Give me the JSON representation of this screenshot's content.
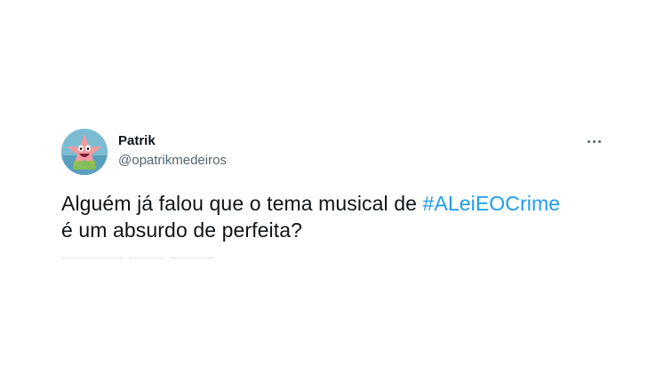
{
  "tweet": {
    "author_name": "Patrik",
    "author_handle": "@opatrikmedeiros",
    "text_before": "Alguém já falou que o tema musical de ",
    "hashtag": "#ALeiEOCrime",
    "text_after": " é um absurdo de perfeita?",
    "avatar_icon": "patrick-star-avatar",
    "more_icon": "more-options-icon"
  },
  "colors": {
    "text": "#0f1419",
    "secondary": "#536471",
    "link": "#1d9bf0"
  }
}
